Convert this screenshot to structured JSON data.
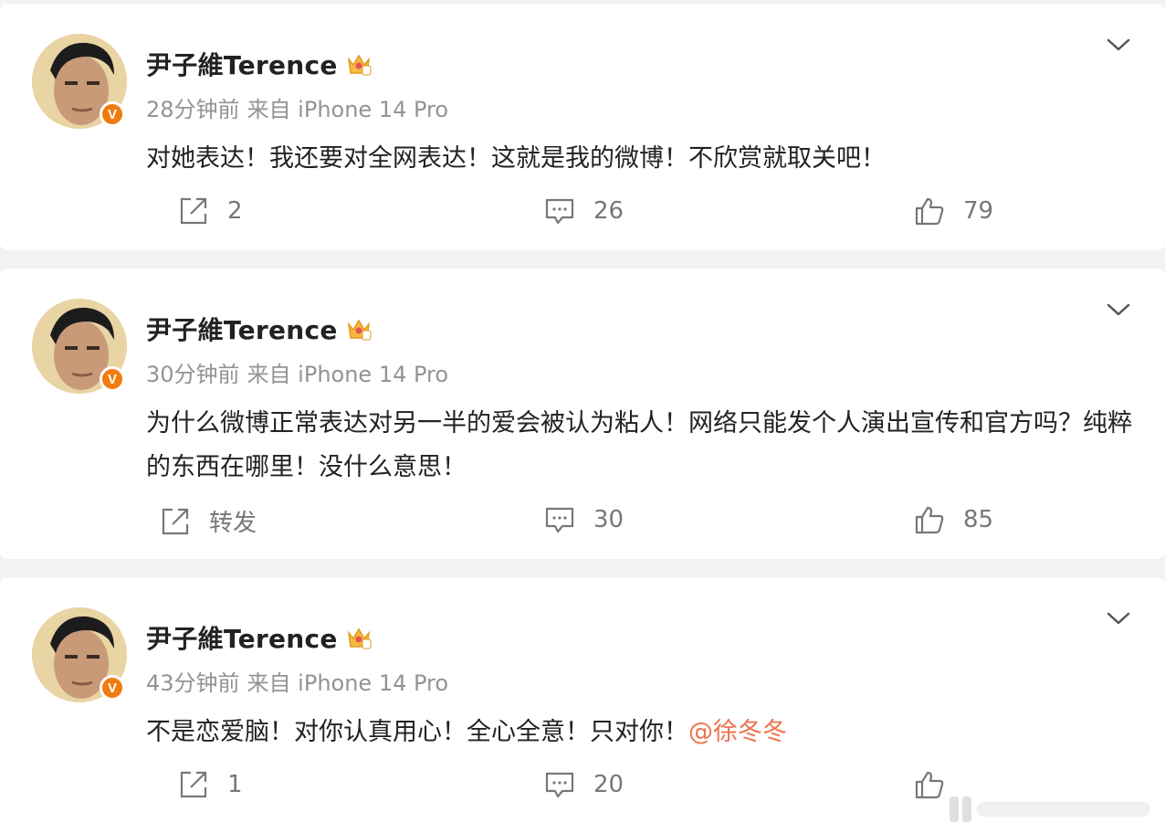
{
  "posts": [
    {
      "author": "尹子維Terence",
      "time": "28分钟前",
      "source": "来自 iPhone 14 Pro",
      "text": "对她表达！我还要对全网表达！这就是我的微博！不欣赏就取关吧！",
      "mention": "",
      "repost": "2",
      "comments": "26",
      "likes": "79"
    },
    {
      "author": "尹子維Terence",
      "time": "30分钟前",
      "source": "来自 iPhone 14 Pro",
      "text": "为什么微博正常表达对另一半的爱会被认为粘人！网络只能发个人演出宣传和官方吗？纯粹的东西在哪里！没什么意思！",
      "mention": "",
      "repost": "转发",
      "comments": "30",
      "likes": "85"
    },
    {
      "author": "尹子維Terence",
      "time": "43分钟前",
      "source": "来自 iPhone 14 Pro",
      "text": "不是恋爱脑！对你认真用心！全心全意！只对你！",
      "mention": "@徐冬冬",
      "repost": "1",
      "comments": "20",
      "likes": ""
    }
  ],
  "badge": {
    "verified": "V"
  },
  "colors": {
    "accent": "#eb7350",
    "verified": "#f07c0f",
    "meta": "#939393",
    "background": "#f2f2f2"
  },
  "icons": [
    "chevron-down-icon",
    "crown-badge-icon",
    "repost-icon",
    "comment-icon",
    "like-icon",
    "verified-badge-icon"
  ]
}
